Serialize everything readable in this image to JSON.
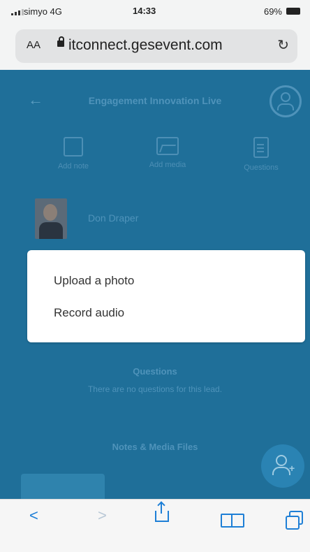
{
  "status_bar": {
    "carrier": "simyo 4G",
    "time": "14:33",
    "battery": "69%"
  },
  "browser": {
    "aa": "AA",
    "url": "itconnect.gesevent.com"
  },
  "page": {
    "title": "Engagement Innovation Live",
    "actions": [
      {
        "label": "Add note"
      },
      {
        "label": "Add media"
      },
      {
        "label": "Questions"
      }
    ],
    "lead_name": "Don Draper",
    "questions_title": "Questions",
    "questions_empty": "There are no questions for this lead.",
    "notes_title": "Notes & Media Files"
  },
  "sheet": {
    "options": [
      "Upload a photo",
      "Record audio"
    ]
  },
  "colors": {
    "page_bg": "#1f6f99",
    "link": "#1e7fd6"
  }
}
